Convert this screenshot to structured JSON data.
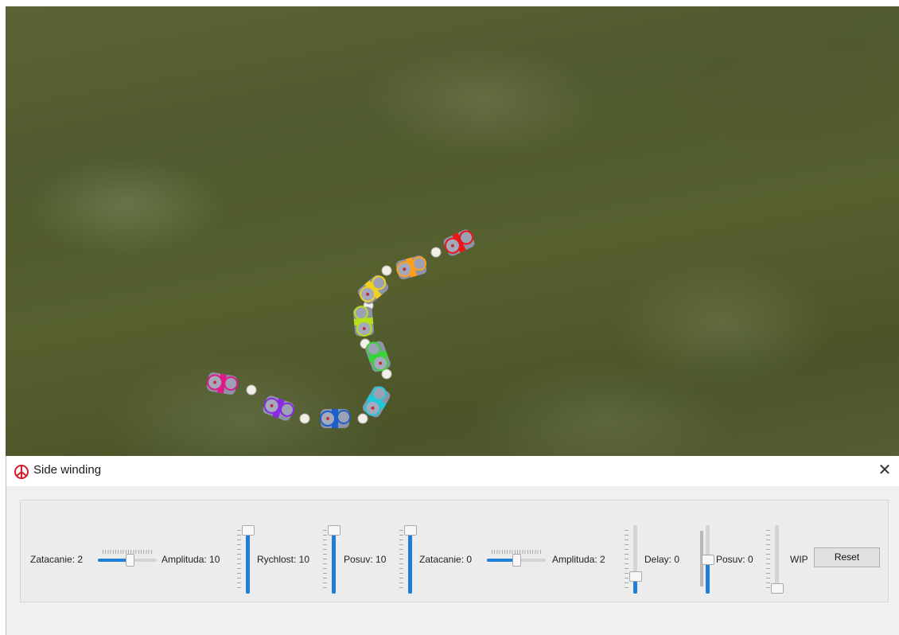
{
  "window": {
    "title": "Side winding",
    "close_glyph": "✕",
    "app_icon": "qt-peace-icon"
  },
  "controls": {
    "zatacanie_1": {
      "label": "Zatacanie:  2",
      "value_fraction": 0.55,
      "orientation": "horizontal"
    },
    "amplituda_1": {
      "label": "Amplituda: 10",
      "value_fraction": 1.0,
      "orientation": "vertical"
    },
    "rychlost": {
      "label": "Rychlost: 10",
      "value_fraction": 1.0,
      "orientation": "vertical"
    },
    "posuv_1": {
      "label": "Posuv: 10",
      "value_fraction": 1.0,
      "orientation": "vertical"
    },
    "zatacanie_2": {
      "label": "Zatacanie:  0",
      "value_fraction": 0.5,
      "orientation": "horizontal"
    },
    "amplituda_2": {
      "label": "Amplituda:  2",
      "value_fraction": 0.2,
      "orientation": "vertical"
    },
    "delay": {
      "label": "Delay:  0",
      "value_fraction": 0.5,
      "orientation": "vertical"
    },
    "posuv_2": {
      "label": "Posuv:  0",
      "value_fraction": 0.0,
      "orientation": "vertical"
    },
    "wip": {
      "label": "WIP"
    }
  },
  "buttons": {
    "reset": "Reset"
  },
  "snake": {
    "segment_colors": [
      "#e0198a",
      "#8a2be2",
      "#1e5ec8",
      "#20c8d8",
      "#3ad23a",
      "#b8e01a",
      "#f0d020",
      "#ff9f1a",
      "#e81818"
    ],
    "body_color": "#8c93a8",
    "joint_color": "#f2efe8",
    "ground": "grass"
  }
}
